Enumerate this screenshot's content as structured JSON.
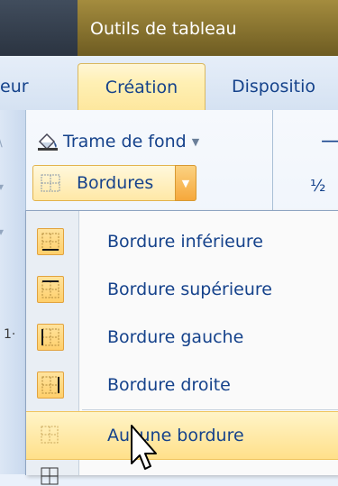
{
  "titlebar": {
    "context_title": "Outils de tableau"
  },
  "tabs": [
    {
      "label": "eur"
    },
    {
      "label": "Création",
      "active": true
    },
    {
      "label": "Dispositio"
    }
  ],
  "ribbon": {
    "trame_label": "Trame de fond",
    "bordures_label": "Bordures",
    "minus_label": "—",
    "half_label": "½",
    "left_frag1": "\\",
    "left_frag2": "▾",
    "left_frag3": "▾",
    "left_frag4": "1·"
  },
  "menu": {
    "items": [
      {
        "label": "Bordure inférieure",
        "icon": "border-bottom-icon"
      },
      {
        "label": "Bordure supérieure",
        "icon": "border-top-icon"
      },
      {
        "label": "Bordure gauche",
        "icon": "border-left-icon"
      },
      {
        "label": "Bordure droite",
        "icon": "border-right-icon"
      },
      {
        "label": "Aucune bordure",
        "icon": "no-border-icon",
        "highlighted": true
      }
    ]
  },
  "colors": {
    "accent": "#ffe08a",
    "text": "#15428b",
    "context_tab": "#a48c3e"
  }
}
